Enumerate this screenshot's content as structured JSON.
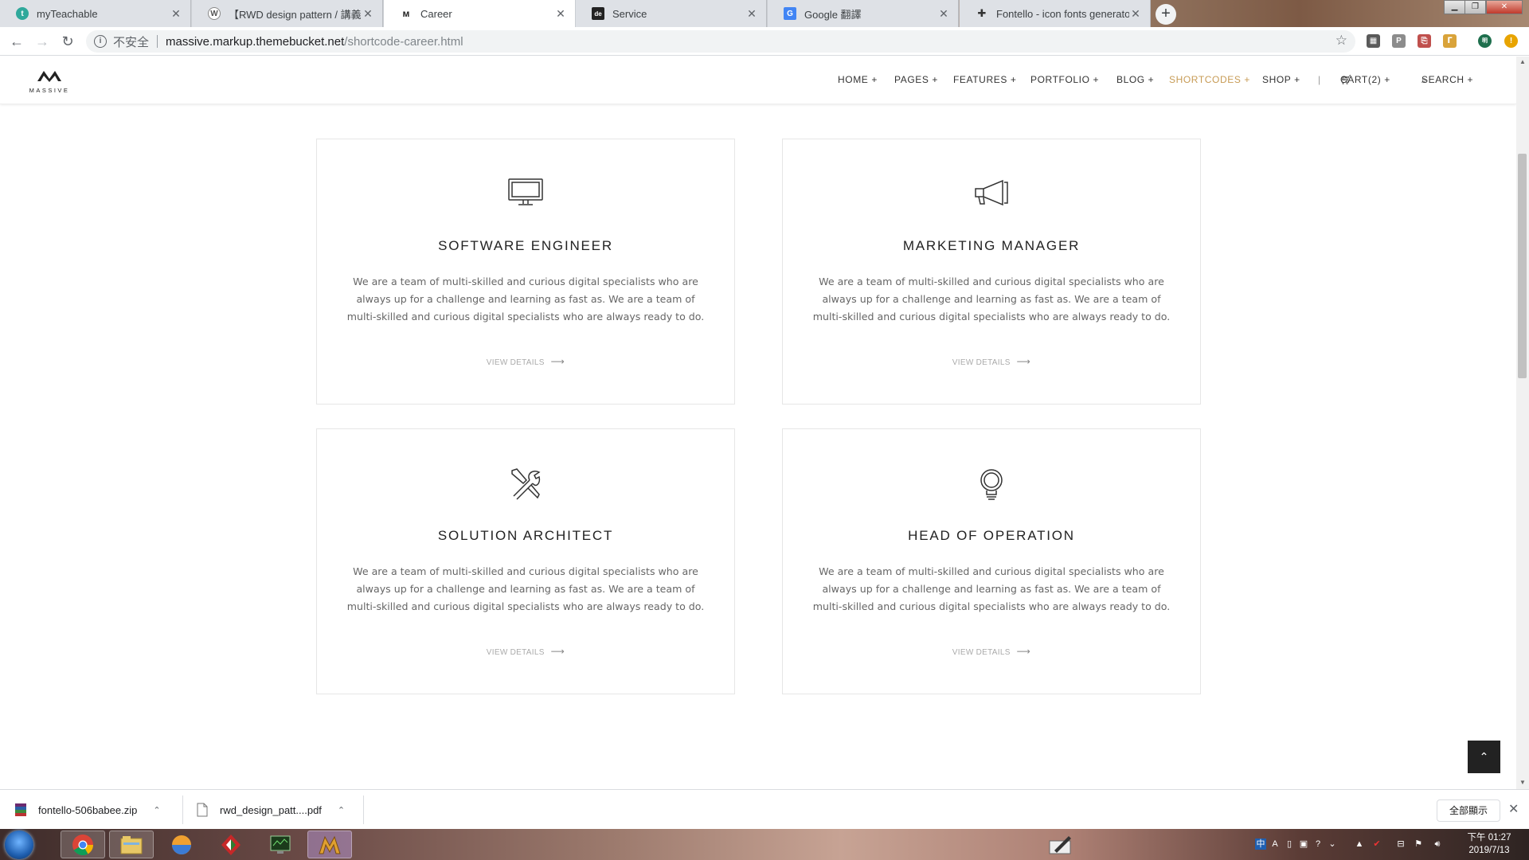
{
  "browser": {
    "tabs": [
      {
        "title": "myTeachable",
        "fav_color": "#2fa89b",
        "fav_glyph": "t"
      },
      {
        "title": "【RWD design pattern / 講義下",
        "fav_color": "#8a8a8a",
        "fav_glyph": "W"
      },
      {
        "title": "Career",
        "fav_color": "#222222",
        "fav_glyph": "M"
      },
      {
        "title": "Service",
        "fav_color": "#222222",
        "fav_glyph": "de"
      },
      {
        "title": "Google 翻譯",
        "fav_color": "#4285f4",
        "fav_glyph": "G"
      },
      {
        "title": "Fontello - icon fonts generator",
        "fav_color": "#555555",
        "fav_glyph": "✚"
      }
    ],
    "security_label": "不安全",
    "url_host": "massive.markup.themebucket.net",
    "url_path": "/shortcode-career.html"
  },
  "site": {
    "logo_text": "MASSIVE",
    "nav": [
      "HOME +",
      "PAGES +",
      "FEATURES +",
      "PORTFOLIO  +",
      "BLOG +",
      "SHORTCODES +",
      "SHOP +",
      "|",
      "CART(2) +",
      "SEARCH +"
    ],
    "active_nav": "SHORTCODES +",
    "accent_color": "#c79b55"
  },
  "cards": [
    {
      "icon": "monitor-icon",
      "title": "SOFTWARE ENGINEER",
      "text": "We are a team of multi-skilled and curious digital specialists who are always up for a challenge and learning as fast as. We are a team of multi-skilled and curious digital specialists who are always ready to do.",
      "link": "VIEW DETAILS"
    },
    {
      "icon": "megaphone-icon",
      "title": "MARKETING MANAGER",
      "text": "We are a team of multi-skilled and curious digital specialists who are always up for a challenge and learning as fast as. We are a team of multi-skilled and curious digital specialists who are always ready to do.",
      "link": "VIEW DETAILS"
    },
    {
      "icon": "tools-icon",
      "title": "SOLUTION ARCHITECT",
      "text": "We are a team of multi-skilled and curious digital specialists who are always up for a challenge and learning as fast as. We are a team of multi-skilled and curious digital specialists who are always ready to do.",
      "link": "VIEW DETAILS"
    },
    {
      "icon": "lightbulb-icon",
      "title": "HEAD OF OPERATION",
      "text": "We are a team of multi-skilled and curious digital specialists who are always up for a challenge and learning as fast as. We are a team of multi-skilled and curious digital specialists who are always ready to do.",
      "link": "VIEW DETAILS"
    }
  ],
  "downloads": {
    "items": [
      "fontello-506babee.zip",
      "rwd_design_patt....pdf"
    ],
    "show_all": "全部顯示"
  },
  "taskbar": {
    "time": "下午 01:27",
    "date": "2019/7/13"
  }
}
